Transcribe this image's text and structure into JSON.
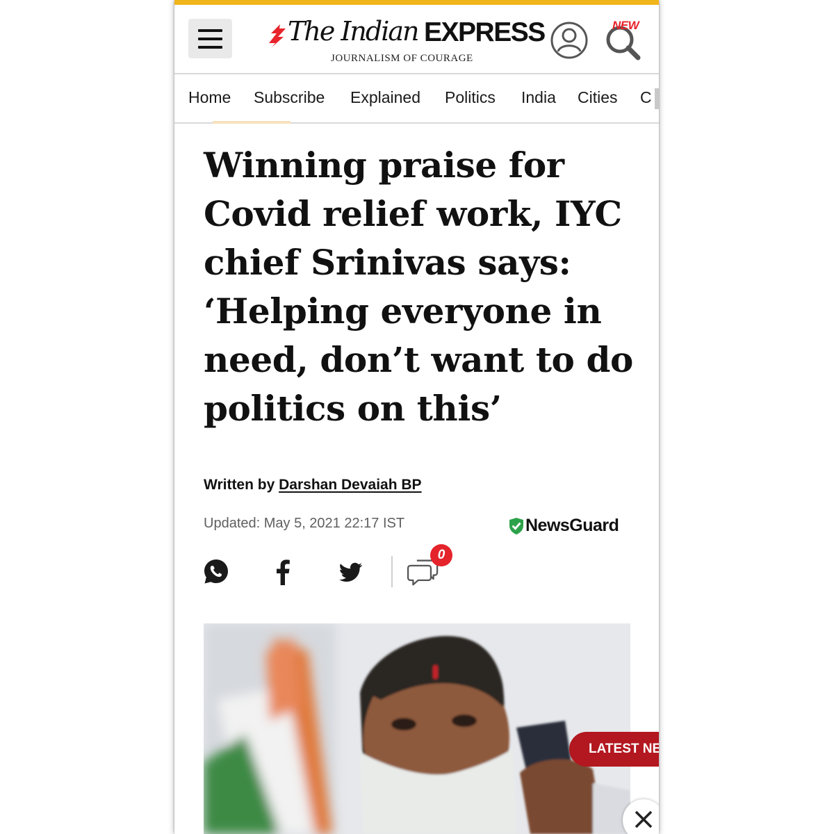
{
  "header": {
    "menu_label": "Menu",
    "brand": {
      "the_indian": "The Indian",
      "express": "EXPRESS",
      "tagline": "JOURNALISM OF COURAGE"
    },
    "new_badge": "NEW",
    "accent_color": "#f1b51c",
    "icons": [
      "hamburger-icon",
      "account-icon",
      "search-icon"
    ]
  },
  "nav": {
    "items": [
      {
        "label": "Home"
      },
      {
        "label": "Subscribe"
      },
      {
        "label": "Explained"
      },
      {
        "label": "Politics"
      },
      {
        "label": "India"
      },
      {
        "label": "Cities"
      },
      {
        "label": "C"
      }
    ]
  },
  "article": {
    "headline": "Winning praise for Covid relief work, IYC chief Srinivas says: ‘Helping everyone in need, don’t want to do politics on this’",
    "byline_prefix": "Written by",
    "author": "Darshan Devaiah BP",
    "updated": "Updated: May 5, 2021 22:17 IST",
    "newsguard_label": "NewsGuard",
    "newsguard_color": "#2ca24a"
  },
  "share": {
    "icons": [
      "whatsapp-icon",
      "facebook-icon",
      "twitter-icon",
      "comments-icon"
    ],
    "comment_count": "0",
    "badge_color": "#e4232b"
  },
  "overlay": {
    "latest_news": "LATEST NEW",
    "latest_color": "#b3171f",
    "close_icon": "close-icon"
  }
}
